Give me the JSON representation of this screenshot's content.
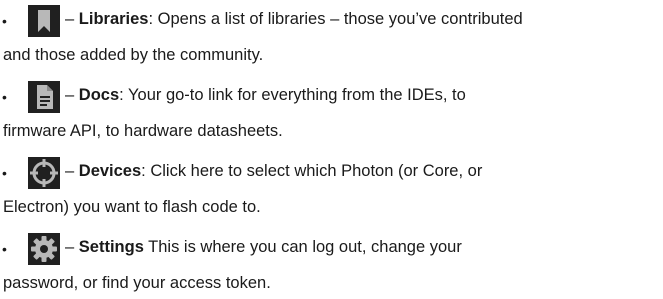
{
  "items": [
    {
      "icon": "bookmark-icon",
      "dash": "–",
      "title": "Libraries",
      "sep": ":",
      "line1_rest": " Opens a list of libraries – those you’ve contributed",
      "line2": "and those added by the community."
    },
    {
      "icon": "document-icon",
      "dash": "–",
      "title": "Docs",
      "sep": ":",
      "line1_rest": " Your go-to link for everything from the IDEs, to",
      "line2": "firmware API, to hardware datasheets."
    },
    {
      "icon": "crosshair-icon",
      "dash": "–",
      "title": "Devices",
      "sep": ":",
      "line1_rest": " Click here to select which Photon (or Core, or",
      "line2": "Electron) you want to flash code to."
    },
    {
      "icon": "gear-icon",
      "dash": "–",
      "title": "Settings",
      "sep": "",
      "line1_rest": " This is where you can log out, change your",
      "line2": "password, or find your access token."
    }
  ],
  "bullet": "•",
  "colors": {
    "icon_background": "#202020",
    "icon_foreground": "#b8b8b8",
    "text": "#1a1a1a"
  }
}
